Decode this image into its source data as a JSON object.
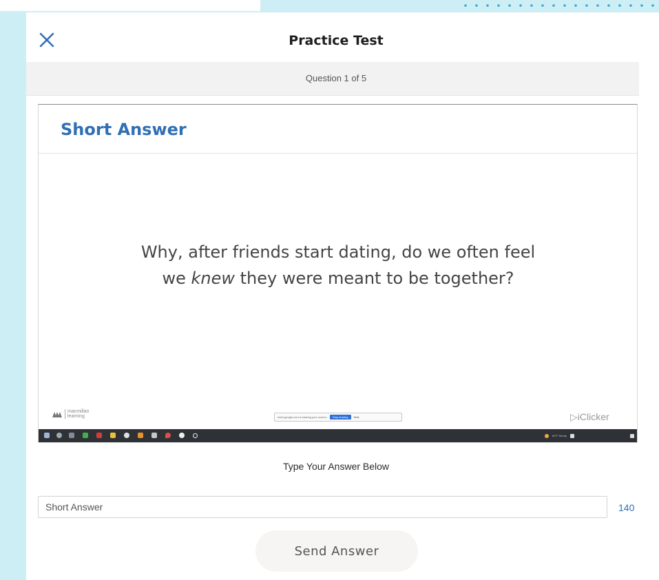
{
  "header": {
    "title": "Practice Test",
    "close_icon": "close-icon"
  },
  "progress": {
    "text": "Question 1 of 5",
    "current": 1,
    "total": 5
  },
  "slide": {
    "heading": "Short Answer",
    "question_part1": "Why, after friends start dating, do we often feel",
    "question_line2_before": "we ",
    "question_emphasis": "knew",
    "question_line2_after": " they were meant to be together?",
    "logo_text": "macmillan learning",
    "share_notice_text": "meet.google.com is sharing your screen.",
    "share_stop_label": "Stop sharing",
    "share_hide_label": "Hide",
    "watermark": "iClicker",
    "taskbar_weather": "81°F Sunny"
  },
  "answer": {
    "prompt": "Type Your Answer Below",
    "placeholder": "Short Answer",
    "value": "",
    "char_count": "140",
    "send_label": "Send Answer"
  },
  "colors": {
    "accent": "#2f6fb3",
    "backdrop": "#cdeef5",
    "dots": "#33a9d8"
  }
}
